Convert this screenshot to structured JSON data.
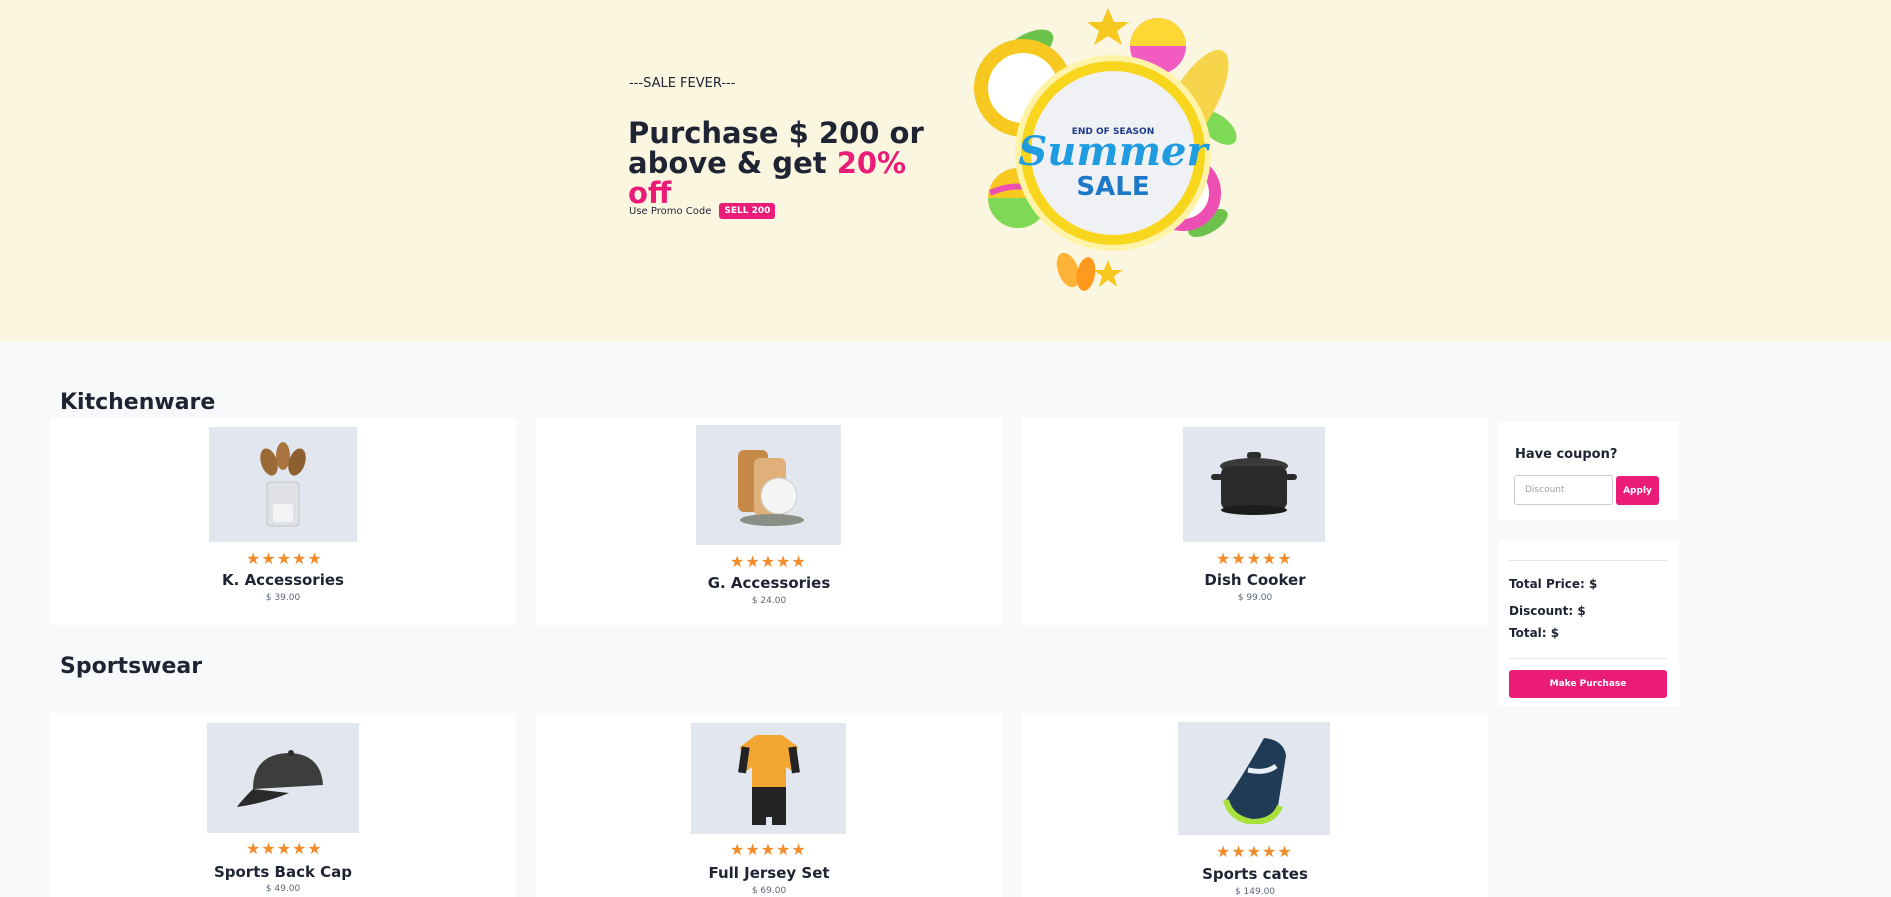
{
  "banner": {
    "eyebrow": "---SALE FEVER---",
    "headline_main": "Purchase $ 200 or above & get ",
    "headline_accent": "20% off",
    "promo_label": "Use Promo Code",
    "promo_code": "SELL 200",
    "sale_art": {
      "top": "END OF SEASON",
      "script": "Summer",
      "bottom": "SALE"
    }
  },
  "sections": [
    {
      "title": "Kitchenware",
      "products": [
        {
          "name": "K. Accessories",
          "price": "$ 39.00",
          "rating": 5,
          "image": "wooden-utensils-icon"
        },
        {
          "name": "G. Accessories",
          "price": "$ 24.00",
          "rating": 5,
          "image": "cutting-boards-icon"
        },
        {
          "name": "Dish Cooker",
          "price": "$ 99.00",
          "rating": 5,
          "image": "cooking-pot-icon"
        }
      ]
    },
    {
      "title": "Sportswear",
      "products": [
        {
          "name": "Sports Back Cap",
          "price": "$ 49.00",
          "rating": 5,
          "image": "cap-icon"
        },
        {
          "name": "Full Jersey Set",
          "price": "$ 69.00",
          "rating": 5,
          "image": "jersey-icon"
        },
        {
          "name": "Sports cates",
          "price": "$ 149.00",
          "rating": 5,
          "image": "sneaker-icon"
        }
      ]
    }
  ],
  "coupon": {
    "title": "Have coupon?",
    "placeholder": "Discount",
    "apply_label": "Apply"
  },
  "summary": {
    "total_price_label": "Total Price: $",
    "discount_label": "Discount: $",
    "total_label": "Total: $",
    "purchase_label": "Make Purchase"
  },
  "colors": {
    "accent": "#ea1c78",
    "banner_bg": "#faf6e0",
    "star": "#f08c2b",
    "thumb_bg": "#e2e6ee"
  }
}
